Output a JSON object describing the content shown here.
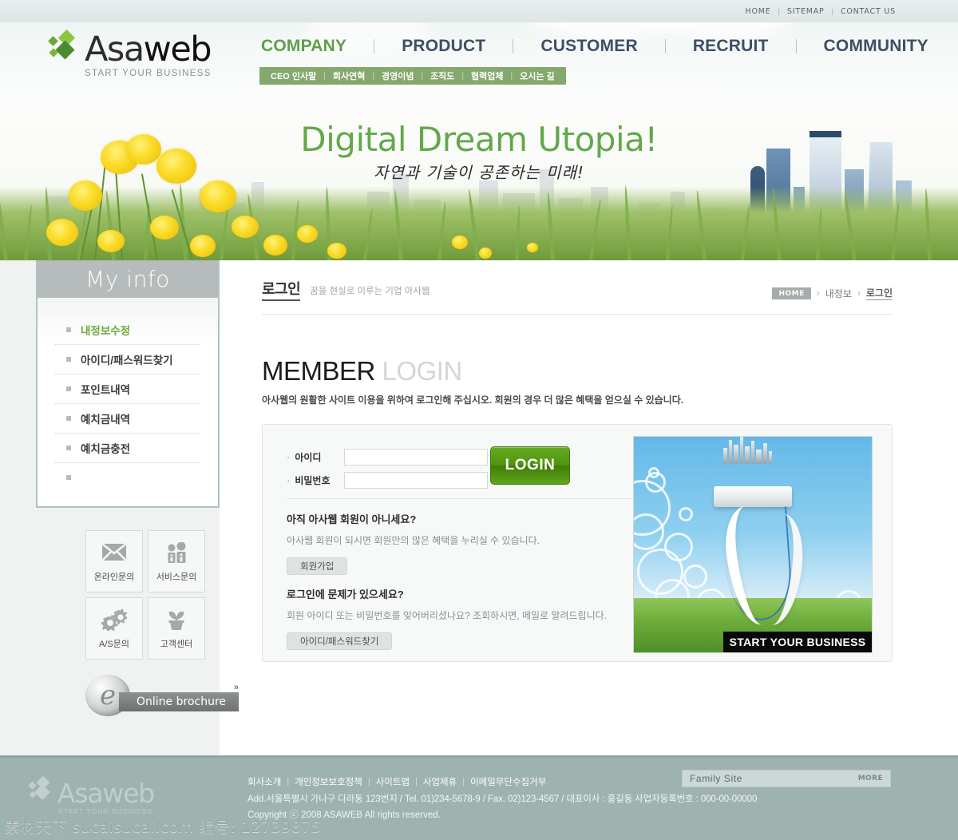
{
  "utility_nav": [
    {
      "label": "HOME"
    },
    {
      "label": "SITEMAP"
    },
    {
      "label": "CONTACT US"
    }
  ],
  "logo": {
    "name_primary": "Asa",
    "name_secondary": "web",
    "tagline": "START YOUR BUSINESS"
  },
  "gnb": [
    {
      "label": "COMPANY",
      "active": true
    },
    {
      "label": "PRODUCT",
      "active": false
    },
    {
      "label": "CUSTOMER",
      "active": false
    },
    {
      "label": "RECRUIT",
      "active": false
    },
    {
      "label": "COMMUNITY",
      "active": false
    }
  ],
  "subnav": [
    {
      "label": "CEO 인사말"
    },
    {
      "label": "회사연혁"
    },
    {
      "label": "경영이념"
    },
    {
      "label": "조직도"
    },
    {
      "label": "협력업체"
    },
    {
      "label": "오시는 길"
    }
  ],
  "hero": {
    "title": "Digital Dream Utopia!",
    "subtitle": "자연과 기술이 공존하는 미래!"
  },
  "sidebar": {
    "title": "My info",
    "items": [
      {
        "label": "내정보수정",
        "active": true
      },
      {
        "label": "아이디/패스워드찾기",
        "active": false
      },
      {
        "label": "포인트내역",
        "active": false
      },
      {
        "label": "예치금내역",
        "active": false
      },
      {
        "label": "예치금충전",
        "active": false
      },
      {
        "label": "",
        "active": false
      }
    ],
    "quick_links": [
      {
        "label": "온라인문의",
        "icon": "envelope-icon"
      },
      {
        "label": "서비스문의",
        "icon": "people-icon"
      },
      {
        "label": "A/S문의",
        "icon": "gears-icon"
      },
      {
        "label": "고객센터",
        "icon": "plant-icon"
      }
    ],
    "brochure": {
      "label": "Online brochure",
      "mark": "e",
      "arrow": "»"
    }
  },
  "content": {
    "page_title": "로그인",
    "page_subtitle": "꿈을 현실로 이루는 기업 아사웹",
    "breadcrumb": {
      "home": "HOME",
      "sep": "›",
      "items": [
        {
          "label": "내정보",
          "current": false
        },
        {
          "label": "로그인",
          "current": true
        }
      ]
    },
    "heading_bold": "MEMBER",
    "heading_light": "LOGIN",
    "heading_desc": "아사웹의 원활한 사이트 이용을 위하여 로그인해 주십시오. 회원의 경우 더 많은 혜택을 얻으실 수 있습니다.",
    "form": {
      "id_label": "아이디",
      "id_value": "",
      "id_placeholder": "",
      "pw_label": "비밀번호",
      "pw_value": "",
      "pw_placeholder": "",
      "submit_label": "LOGIN",
      "bullet": "·"
    },
    "blocks": [
      {
        "title": "아직 아사웹 회원이 아니세요?",
        "desc": "아사웹 회원이 되시면 회원만의 많은 혜택을 누리실 수 있습니다.",
        "button": "회원가입"
      },
      {
        "title": "로그인에 문제가 있으세요?",
        "desc": "회원 아이디 또는 비밀번호를 잊어버리셨나요? 조회하시면, 메일로 알려드립니다.",
        "button": "아이디/패스워드찾기"
      }
    ],
    "promo": {
      "caption": "START YOUR BUSINESS"
    }
  },
  "footer": {
    "logo": {
      "name_primary": "Asa",
      "name_secondary": "web",
      "tagline": "START YOUR BUSINESS"
    },
    "links": [
      {
        "label": "회사소개"
      },
      {
        "label": "개인정보보호정책"
      },
      {
        "label": "사이트맵"
      },
      {
        "label": "사업제휴"
      },
      {
        "label": "이메일무단수집거부"
      }
    ],
    "address": "Add.서울특별시 가나구 다라동 123번지 / Tel. 01)234-5678-9 / Fax. 02)123-4567 / 대표이사 : 홍길동  사업자등록번호 : 000-00-00000",
    "copyright": "Copyright ⓒ 2008 ASAWEB  All rights reserved.",
    "family_site": {
      "label": "Family  Site",
      "more": "MORE"
    }
  },
  "watermark": "素材天下 sucaisucai.com  编号: 12739875",
  "colors": {
    "brand_green": "#6fa83f",
    "nav_navy": "#3f4e63",
    "subnav_green": "#84a86d",
    "footer_teal": "#9eb3b0",
    "login_button": "#4f9411"
  }
}
